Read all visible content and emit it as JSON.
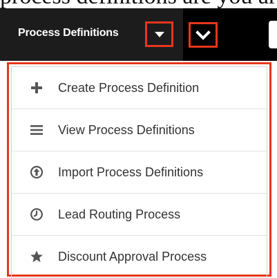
{
  "page": {
    "top_text": "process definitions are you are"
  },
  "nav": {
    "module_label": "Process Definitions",
    "module_caret_icon": "caret-down-icon",
    "menu_toggle_icon": "chevron-down-icon"
  },
  "colors": {
    "navbar_bg": "#000000",
    "module_bg": "#1c1c1c",
    "highlight": "#e8361c",
    "menu_text": "#333333",
    "icon_color": "#555555"
  },
  "menu": {
    "items": [
      {
        "label": "Create Process Definition",
        "icon": "plus-icon"
      },
      {
        "label": "View Process Definitions",
        "icon": "list-icon"
      },
      {
        "label": "Import Process Definitions",
        "icon": "import-icon"
      },
      {
        "label": "Lead Routing Process",
        "icon": "clock-icon"
      },
      {
        "label": "Discount Approval Process",
        "icon": "star-icon"
      }
    ]
  }
}
